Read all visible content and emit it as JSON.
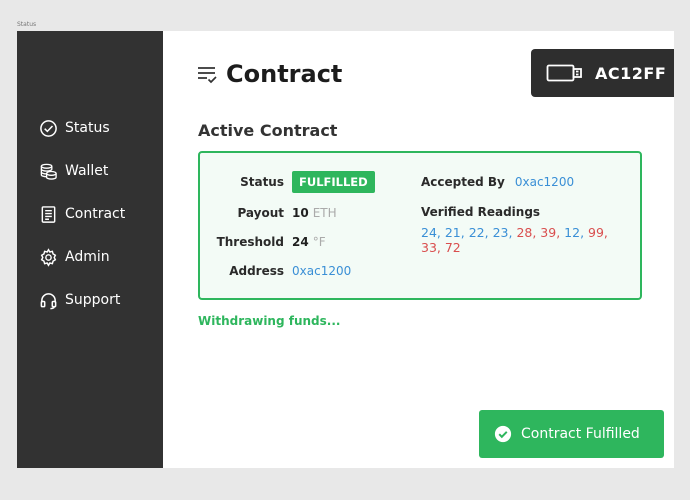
{
  "frame_label": "Status",
  "sidebar": {
    "items": [
      {
        "label": "Status",
        "icon": "check-circle-icon"
      },
      {
        "label": "Wallet",
        "icon": "coins-icon"
      },
      {
        "label": "Contract",
        "icon": "document-icon"
      },
      {
        "label": "Admin",
        "icon": "gear-icon"
      },
      {
        "label": "Support",
        "icon": "headset-icon"
      }
    ]
  },
  "header": {
    "title": "Contract",
    "icon": "list-check-icon",
    "device": {
      "icon": "usb-drive-icon",
      "id": "AC12FF"
    }
  },
  "contract": {
    "section_title": "Active Contract",
    "status_label": "Status",
    "status_value": "FULFILLED",
    "payout_label": "Payout",
    "payout_value": "10",
    "payout_unit": "ETH",
    "threshold_label": "Threshold",
    "threshold_value": "24",
    "threshold_unit": "°F",
    "address_label": "Address",
    "address_value": "0xac1200",
    "accepted_by_label": "Accepted By",
    "accepted_by_value": "0xac1200",
    "readings_label": "Verified Readings",
    "readings": [
      {
        "text": "24",
        "state": "ok"
      },
      {
        "text": "21",
        "state": "ok"
      },
      {
        "text": "22",
        "state": "ok"
      },
      {
        "text": "23",
        "state": "ok"
      },
      {
        "text": "28",
        "state": "over"
      },
      {
        "text": "39",
        "state": "over"
      },
      {
        "text": "12",
        "state": "ok"
      },
      {
        "text": "99",
        "state": "over"
      },
      {
        "text": "33",
        "state": "over"
      },
      {
        "text": "72",
        "state": "over"
      }
    ]
  },
  "status_message": "Withdrawing funds...",
  "toast": {
    "text": "Contract Fulfilled",
    "icon": "check-circle-icon"
  },
  "colors": {
    "accent_green": "#2eb65d",
    "link_blue": "#3a8fd6",
    "alert_red": "#d94e4e",
    "sidebar_bg": "#323232"
  }
}
